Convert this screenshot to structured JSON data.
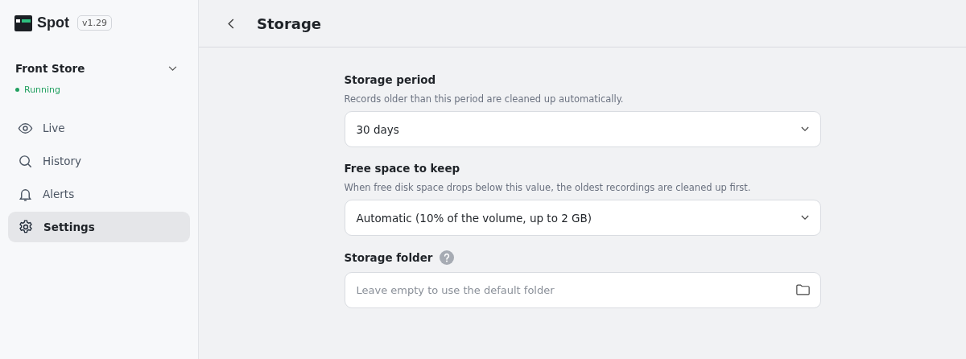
{
  "app": {
    "name": "Spot",
    "version": "v1.29"
  },
  "instance": {
    "name": "Front Store",
    "status": "Running",
    "color": "#22a060"
  },
  "nav": [
    {
      "label": "Live",
      "kind": "eye",
      "selected": false
    },
    {
      "label": "History",
      "kind": "search",
      "selected": false
    },
    {
      "label": "Alerts",
      "kind": "bell",
      "selected": false
    },
    {
      "label": "Settings",
      "kind": "gear",
      "selected": true
    }
  ],
  "page": {
    "title": "Storage"
  },
  "fields": [
    {
      "kind": "select",
      "label": "Storage period",
      "help": "Records older than this period are cleaned up automatically.",
      "value": "30 days"
    },
    {
      "kind": "select",
      "label": "Free space to keep",
      "help": "When free disk space drops below this value, the oldest recordings are cleaned up first.",
      "value": "Automatic (10% of the volume, up to 2 GB)"
    },
    {
      "kind": "folder",
      "label": "Storage folder",
      "info": true,
      "placeholder": "Leave empty to use the default folder"
    }
  ]
}
